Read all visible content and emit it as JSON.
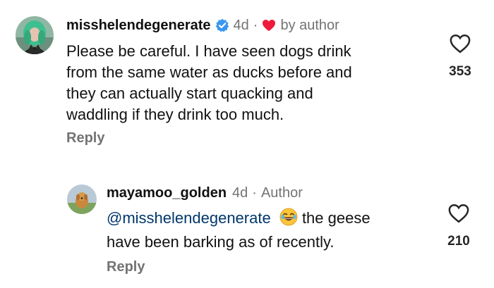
{
  "colors": {
    "text": "#111111",
    "muted": "#737373",
    "verified": "#3897f0",
    "heart_red": "#ed1c3a",
    "mention": "#00376b"
  },
  "comments": [
    {
      "username": "misshelendegenerate",
      "verified": true,
      "time": "4d",
      "separator": "·",
      "liked_by_author_label": "by author",
      "text": "Please be careful. I have seen dogs drink from the same water as ducks before and they can actually start quacking and waddling if they drink too much.",
      "text_lines": [
        "Please be careful. I have seen dogs drink",
        "from the same water as ducks before and",
        "they can actually start quacking and",
        "waddling if they drink too much."
      ],
      "reply_label": "Reply",
      "likes": "353",
      "avatar_icon": "avatar-green-hair-person"
    },
    {
      "username": "mayamoo_golden",
      "time": "4d",
      "separator": "·",
      "author_label": "Author",
      "mention": "@misshelendegenerate",
      "emoji": "😂",
      "text_line1_rest": " the geese",
      "text_line2": "have been barking as of recently.",
      "reply_label": "Reply",
      "likes": "210",
      "avatar_icon": "avatar-golden-retriever"
    }
  ]
}
